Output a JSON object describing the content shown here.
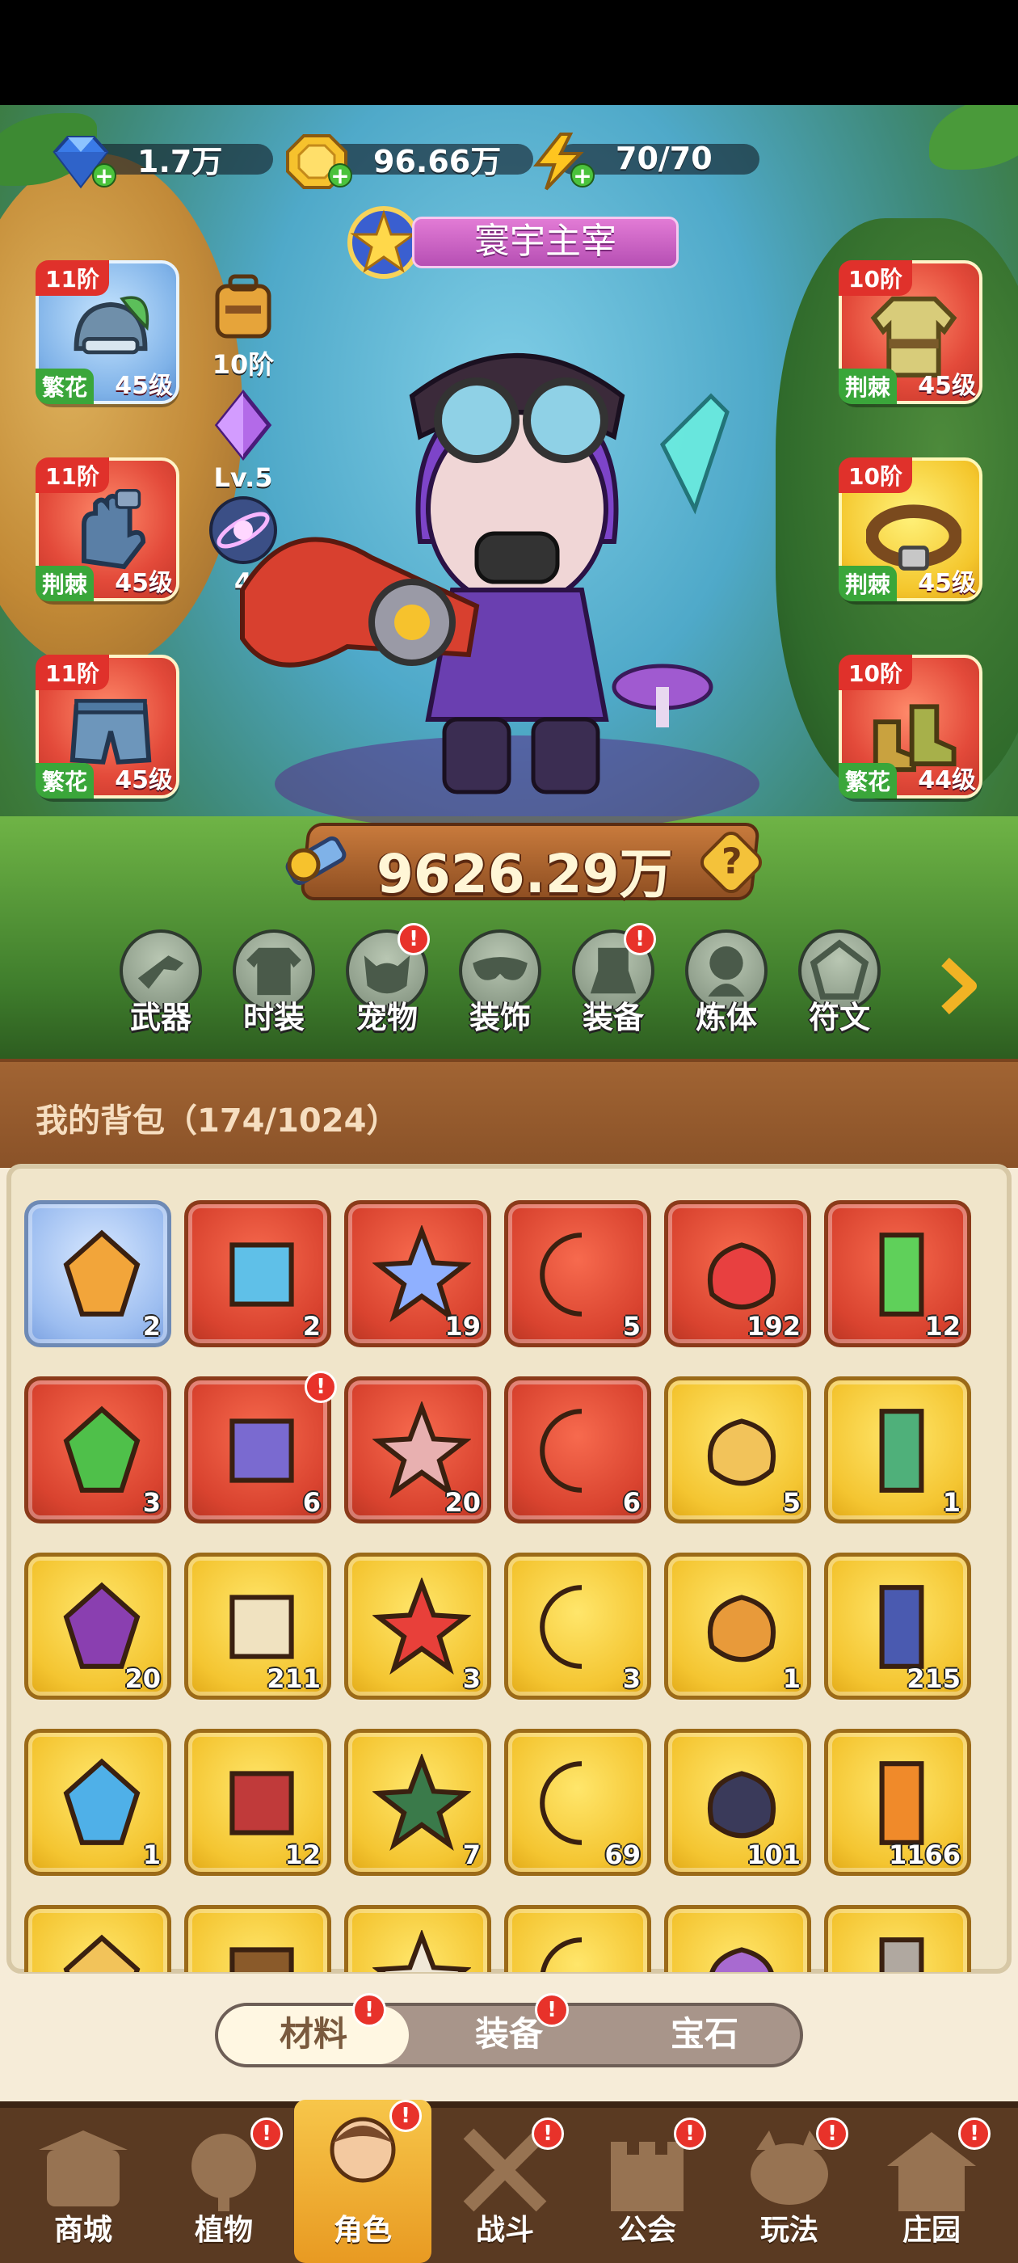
{
  "top": {
    "currencies": [
      {
        "icon": "diamond-icon",
        "value": "1.7万"
      },
      {
        "icon": "gold-coin-icon",
        "value": "96.66万"
      },
      {
        "icon": "lightning-energy-icon",
        "value": "70/70"
      }
    ],
    "title_badge": "寰宇主宰"
  },
  "character": {
    "left_equipment": [
      {
        "tier": "11阶",
        "tag": "繁花",
        "level": "45级",
        "icon": "helmet-icon",
        "style": "white"
      },
      {
        "tier": "11阶",
        "tag": "荆棘",
        "level": "45级",
        "icon": "gloves-icon",
        "style": "red"
      },
      {
        "tier": "11阶",
        "tag": "繁花",
        "level": "45级",
        "icon": "shorts-icon",
        "style": "red"
      }
    ],
    "right_equipment": [
      {
        "tier": "10阶",
        "tag": "荆棘",
        "level": "45级",
        "icon": "jacket-icon",
        "style": "red"
      },
      {
        "tier": "10阶",
        "tag": "荆棘",
        "level": "45级",
        "icon": "belt-icon",
        "style": "gold"
      },
      {
        "tier": "10阶",
        "tag": "繁花",
        "level": "44级",
        "icon": "boots-icon",
        "style": "red"
      }
    ],
    "side_items": [
      {
        "label": "10阶",
        "icon": "backpack-icon"
      },
      {
        "label": "Lv.5",
        "icon": "purple-gem-icon"
      },
      {
        "label": "4",
        "icon": "planet-orb-icon"
      }
    ],
    "power": "9626.29万",
    "power_help": "?"
  },
  "nav_icons": [
    {
      "label": "武器",
      "icon": "weapon-icon",
      "alert": false
    },
    {
      "label": "时装",
      "icon": "outfit-icon",
      "alert": false
    },
    {
      "label": "宠物",
      "icon": "pet-icon",
      "alert": true
    },
    {
      "label": "装饰",
      "icon": "mask-icon",
      "alert": false
    },
    {
      "label": "装备",
      "icon": "equipment-icon",
      "alert": true
    },
    {
      "label": "炼体",
      "icon": "body-refine-icon",
      "alert": false
    },
    {
      "label": "符文",
      "icon": "rune-icon",
      "alert": false
    }
  ],
  "alert_mark": "!",
  "bag": {
    "title": "我的背包（174/1024）",
    "items": [
      {
        "icon": "syringe-icon",
        "count": "2",
        "style": "w"
      },
      {
        "icon": "rubik-cube-icon",
        "count": "2",
        "style": "r"
      },
      {
        "icon": "blue-star-crystal-icon",
        "count": "19",
        "style": "r"
      },
      {
        "icon": "moon-star-icon",
        "count": "5",
        "style": "r"
      },
      {
        "icon": "red-potion-flask-icon",
        "count": "192",
        "style": "r"
      },
      {
        "icon": "green-battery-icon",
        "count": "12",
        "style": "r"
      },
      {
        "icon": "green-capsule-icon",
        "count": "3",
        "style": "r"
      },
      {
        "icon": "scroll-chest-icon",
        "count": "6",
        "style": "r",
        "alert": true
      },
      {
        "icon": "triquetra-rune-icon",
        "count": "20",
        "style": "r"
      },
      {
        "icon": "summon-fire-icon",
        "count": "6",
        "style": "r"
      },
      {
        "icon": "golden-vase-icon",
        "count": "5",
        "style": "y"
      },
      {
        "icon": "green-fish-icon",
        "count": "1",
        "style": "y"
      },
      {
        "icon": "skull-scroll-icon",
        "count": "20",
        "style": "y"
      },
      {
        "icon": "open-book-icon",
        "count": "211",
        "style": "y"
      },
      {
        "icon": "red-key-icon",
        "count": "3",
        "style": "y"
      },
      {
        "icon": "gold-key-icon",
        "count": "3",
        "style": "y"
      },
      {
        "icon": "green-key-icon",
        "count": "1",
        "style": "y"
      },
      {
        "icon": "fire-prism-icon",
        "count": "215",
        "style": "y"
      },
      {
        "icon": "blue-mushroom-icon",
        "count": "1",
        "style": "y"
      },
      {
        "icon": "red-tome-icon",
        "count": "12",
        "style": "y"
      },
      {
        "icon": "green-cube-icon",
        "count": "7",
        "style": "y"
      },
      {
        "icon": "golden-bud-icon",
        "count": "69",
        "style": "y"
      },
      {
        "icon": "dark-rune-stone-icon",
        "count": "101",
        "style": "y"
      },
      {
        "icon": "orange-potion-icon",
        "count": "1166",
        "style": "y"
      },
      {
        "icon": "gold-crystal-icon",
        "count": "",
        "style": "y"
      },
      {
        "icon": "clay-pot-icon",
        "count": "",
        "style": "y"
      },
      {
        "icon": "bone-icon",
        "count": "",
        "style": "y"
      },
      {
        "icon": "food-bowl-icon",
        "count": "",
        "style": "y"
      },
      {
        "icon": "purple-book-icon",
        "count": "",
        "style": "y"
      },
      {
        "icon": "grey-ore-icon",
        "count": "",
        "style": "y"
      }
    ]
  },
  "tabs": [
    {
      "label": "材料",
      "active": true,
      "alert": true
    },
    {
      "label": "装备",
      "active": false,
      "alert": true
    },
    {
      "label": "宝石",
      "active": false,
      "alert": false
    }
  ],
  "bottom_nav": [
    {
      "label": "商城",
      "icon": "shop-icon",
      "active": false,
      "alert": false
    },
    {
      "label": "植物",
      "icon": "plant-icon",
      "active": false,
      "alert": true
    },
    {
      "label": "角色",
      "icon": "character-avatar-icon",
      "active": true,
      "alert": true
    },
    {
      "label": "战斗",
      "icon": "battle-swords-icon",
      "active": false,
      "alert": true
    },
    {
      "label": "公会",
      "icon": "guild-castle-icon",
      "active": false,
      "alert": true
    },
    {
      "label": "玩法",
      "icon": "gameplay-icon",
      "active": false,
      "alert": true
    },
    {
      "label": "庄园",
      "icon": "manor-icon",
      "active": false,
      "alert": true
    }
  ],
  "colors": {
    "red_item_bg": "#d9432f",
    "gold_item_bg": "#f4c531",
    "alert_red": "#e8322a",
    "bag_header": "#8a5228",
    "tag_green": "#3aa63a"
  }
}
